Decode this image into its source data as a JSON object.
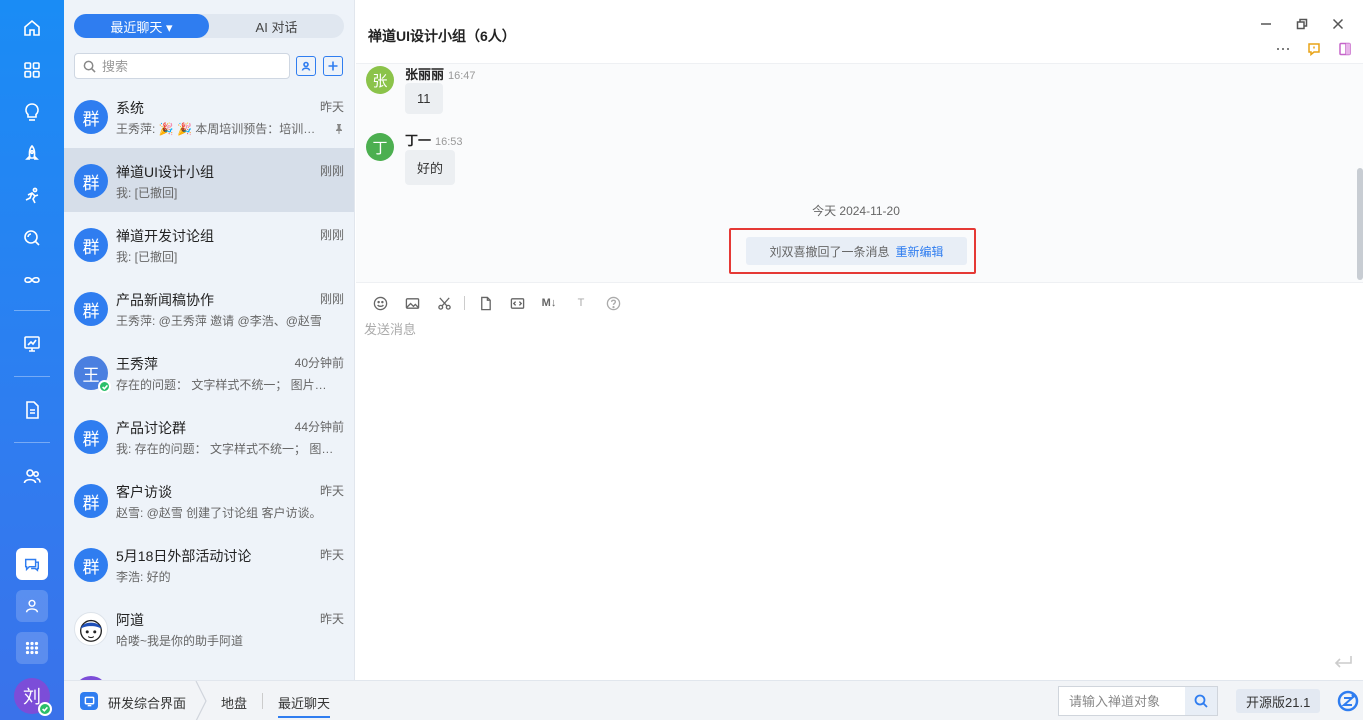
{
  "chat_tabs": {
    "recent_label": "最近聊天 ▾",
    "ai_label": "AI 对话"
  },
  "search": {
    "placeholder": "搜索"
  },
  "chat_list": [
    {
      "avatar": "群",
      "title": "系统",
      "time": "昨天",
      "preview": "王秀萍: 🎉 🎉 本周培训预告：培训主题",
      "pinned": true
    },
    {
      "avatar": "群",
      "title": "禅道UI设计小组",
      "time": "刚刚",
      "preview": "我: [已撤回]"
    },
    {
      "avatar": "群",
      "title": "禅道开发讨论组",
      "time": "刚刚",
      "preview": "我: [已撤回]"
    },
    {
      "avatar": "群",
      "title": "产品新闻稿协作",
      "time": "刚刚",
      "preview": "王秀萍: @王秀萍 邀请 @李浩、@赵雪"
    },
    {
      "avatar": "王",
      "title": "王秀萍",
      "time": "40分钟前",
      "preview": "存在的问题： 文字样式不统一； 图片大小不统一"
    },
    {
      "avatar": "群",
      "title": "产品讨论群",
      "time": "44分钟前",
      "preview": "我: 存在的问题： 文字样式不统一； 图片大小"
    },
    {
      "avatar": "群",
      "title": "客户访谈",
      "time": "昨天",
      "preview": "赵雪: @赵雪 创建了讨论组 客户访谈。"
    },
    {
      "avatar": "群",
      "title": "5月18日外部活动讨论",
      "time": "昨天",
      "preview": "李浩: 好的"
    },
    {
      "avatar": "",
      "title": "阿道",
      "time": "昨天",
      "preview": "哈喽~我是你的助手阿道"
    }
  ],
  "conversation": {
    "title": "禅道UI设计小组（6人）",
    "messages": [
      {
        "avatar": "张",
        "avatar_color": "#8bc34a",
        "name": "张丽丽",
        "time": "16:47",
        "text": "11"
      },
      {
        "avatar": "丁",
        "avatar_color": "#4caf50",
        "name": "丁一",
        "time": "16:53",
        "text": "好的"
      }
    ],
    "date_separator": "今天 2024-11-20",
    "recall_notice": "刘双喜撤回了一条消息",
    "reedit_label": "重新编辑"
  },
  "editor": {
    "placeholder": "发送消息",
    "toolbar": {
      "markdown_label": "M↓",
      "text_label": "T"
    }
  },
  "me": {
    "avatar": "刘"
  },
  "bottom_bar": {
    "app_label": "研发综合界面",
    "crumb_1": "地盘",
    "crumb_2": "最近聊天",
    "object_search_placeholder": "请输入禅道对象",
    "version": "开源版21.1"
  },
  "colors": {
    "accent": "#2f7df0",
    "highlight_border": "#e53935"
  }
}
